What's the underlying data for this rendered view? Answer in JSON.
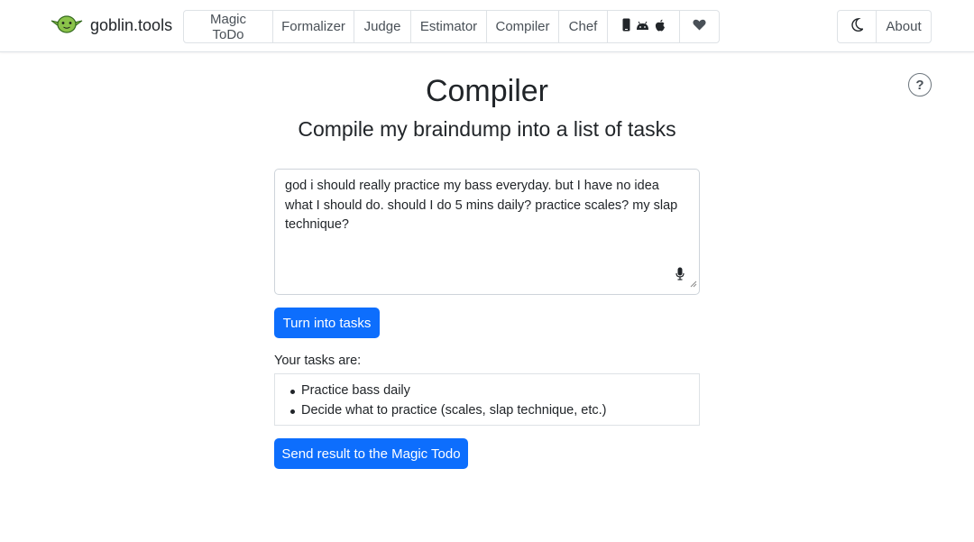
{
  "brand": {
    "name": "goblin.tools"
  },
  "nav": {
    "items": [
      {
        "label": "Magic ToDo"
      },
      {
        "label": "Formalizer"
      },
      {
        "label": "Judge"
      },
      {
        "label": "Estimator"
      },
      {
        "label": "Compiler"
      },
      {
        "label": "Chef"
      }
    ],
    "apps_icons": [
      "mobile-phone-icon",
      "android-icon",
      "apple-icon"
    ],
    "support_icon": "heart-icon",
    "theme_icon": "moon-icon",
    "about_label": "About"
  },
  "help": {
    "symbol": "?"
  },
  "page": {
    "title": "Compiler",
    "subtitle": "Compile my braindump into a list of tasks"
  },
  "input": {
    "value": "god i should really practice my bass everyday. but I have no idea what I should do. should I do 5 mins daily? practice scales? my slap technique?",
    "mic_icon": "microphone-icon"
  },
  "actions": {
    "turn_into_tasks": "Turn into tasks",
    "send_result": "Send result to the Magic Todo"
  },
  "results": {
    "label": "Your tasks are:",
    "tasks": [
      "Practice bass daily",
      "Decide what to practice (scales, slap technique, etc.)"
    ]
  },
  "colors": {
    "primary": "#0d6efd",
    "goblin_green": "#8bc34a"
  }
}
